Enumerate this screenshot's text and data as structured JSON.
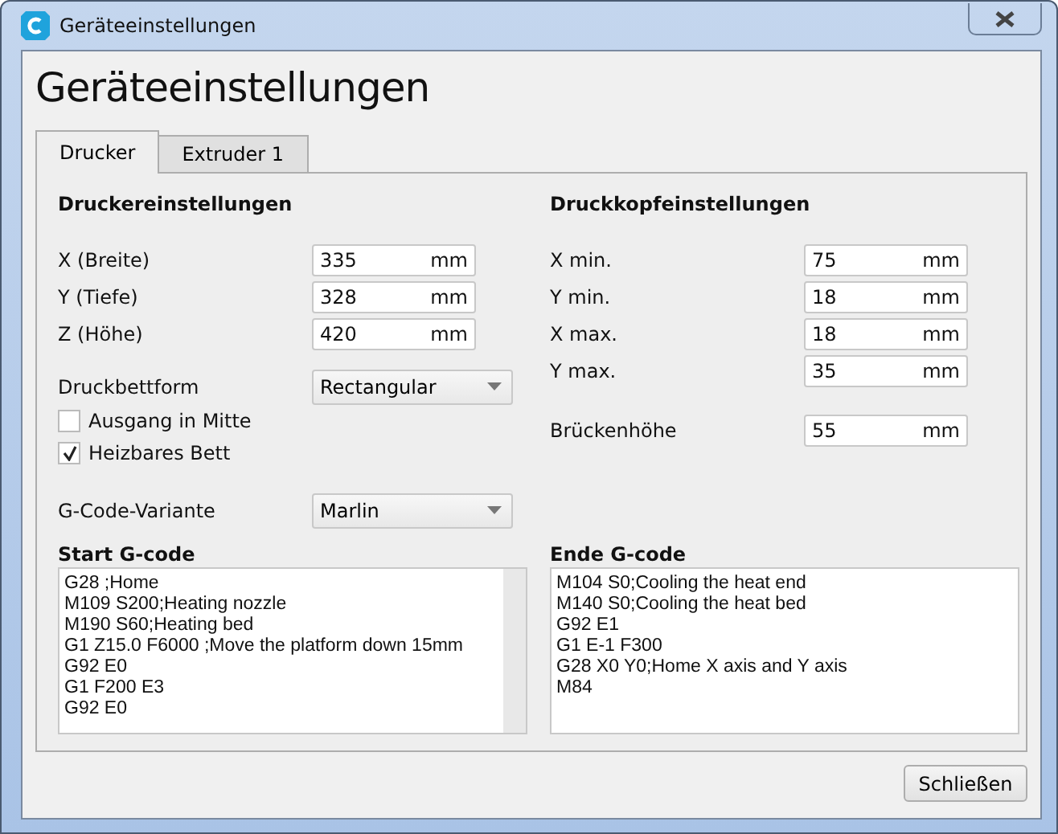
{
  "window": {
    "title": "Geräteeinstellungen"
  },
  "heading": "Geräteeinstellungen",
  "tabs": [
    {
      "label": "Drucker",
      "selected": true
    },
    {
      "label": "Extruder 1",
      "selected": false
    }
  ],
  "printer_settings": {
    "title": "Druckereinstellungen",
    "fields": [
      {
        "label": "X (Breite)",
        "value": "335",
        "unit": "mm"
      },
      {
        "label": "Y (Tiefe)",
        "value": "328",
        "unit": "mm"
      },
      {
        "label": "Z (Höhe)",
        "value": "420",
        "unit": "mm"
      }
    ],
    "bed_shape": {
      "label": "Druckbettform",
      "value": "Rectangular"
    },
    "checkboxes": [
      {
        "label": "Ausgang in Mitte",
        "checked": false
      },
      {
        "label": "Heizbares Bett",
        "checked": true
      }
    ],
    "gcode_flavor": {
      "label": "G-Code-Variante",
      "value": "Marlin"
    }
  },
  "head_settings": {
    "title": "Druckkopfeinstellungen",
    "fields": [
      {
        "label": "X min.",
        "value": "75",
        "unit": "mm"
      },
      {
        "label": "Y min.",
        "value": "18",
        "unit": "mm"
      },
      {
        "label": "X max.",
        "value": "18",
        "unit": "mm"
      },
      {
        "label": "Y max.",
        "value": "35",
        "unit": "mm"
      }
    ],
    "bridge": {
      "label": "Brückenhöhe",
      "value": "55",
      "unit": "mm"
    }
  },
  "start_gcode": {
    "title": "Start G-code",
    "lines": [
      "G28 ;Home",
      "M109 S200;Heating nozzle",
      "M190 S60;Heating bed",
      "G1 Z15.0 F6000 ;Move the platform down 15mm",
      "G92 E0",
      "G1 F200 E3",
      "G92 E0"
    ]
  },
  "end_gcode": {
    "title": "Ende G-code",
    "lines": [
      "M104 S0;Cooling the heat end",
      "M140 S0;Cooling the heat bed",
      "G92 E1",
      "G1 E-1 F300",
      "G28 X0 Y0;Home X axis and Y axis",
      "M84"
    ]
  },
  "buttons": [
    "Schließen"
  ]
}
